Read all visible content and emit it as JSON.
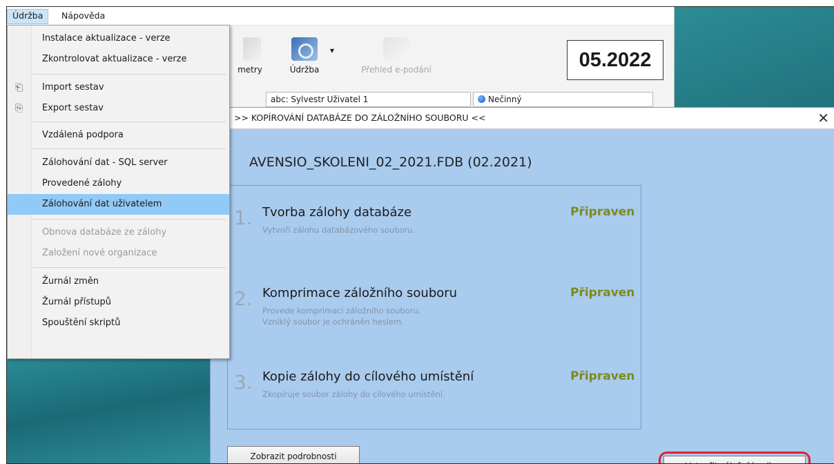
{
  "menubar": {
    "items": [
      "Údržba",
      "Nápověda"
    ]
  },
  "ribbon": {
    "param_label": "metry",
    "udrzba_label": "Údržba",
    "prehled_label": "Přehled e-podání",
    "date_display": "05.2022"
  },
  "status": {
    "user": "abc: Sylvestr Uživatel 1",
    "state": "Nečinný"
  },
  "dropdown": {
    "items": [
      "Instalace aktualizace - verze",
      "Zkontrolovat aktualizace - verze",
      "Import sestav",
      "Export sestav",
      "Vzdálená podpora",
      "Zálohování dat - SQL server",
      "Provedené zálohy",
      "Zálohování dat uživatelem",
      "Obnova databáze ze zálohy",
      "Založení nové organizace",
      "Žurnál změn",
      "Žurnál přístupů",
      "Spouštění skriptů"
    ]
  },
  "dialog": {
    "title": ">> KOPÍROVÁNÍ DATABÁZE DO ZÁLOŽNÍHO SOUBORU <<",
    "close": "✕",
    "database": "AVENSIO_SKOLENI_02_2021.FDB (02.2021)",
    "steps": [
      {
        "num": "1.",
        "title": "Tvorba zálohy databáze",
        "desc": "Vytvoří zálohu databázového souboru.",
        "desc2": "",
        "state": "Připraven"
      },
      {
        "num": "2.",
        "title": "Komprimace záložního souboru",
        "desc": "Provede komprimaci záložního souboru.",
        "desc2": "Vzniklý soubor je ochráněn heslem.",
        "state": "Připraven"
      },
      {
        "num": "3.",
        "title": "Kopie zálohy do cílového umístění",
        "desc": "Zkopíruje soubor zálohy do cílového umístění.",
        "desc2": "",
        "state": "Připraven"
      }
    ],
    "details_button": "Zobrazit podrobnosti",
    "create_button": "Vytvořit záložní kopii ->"
  }
}
